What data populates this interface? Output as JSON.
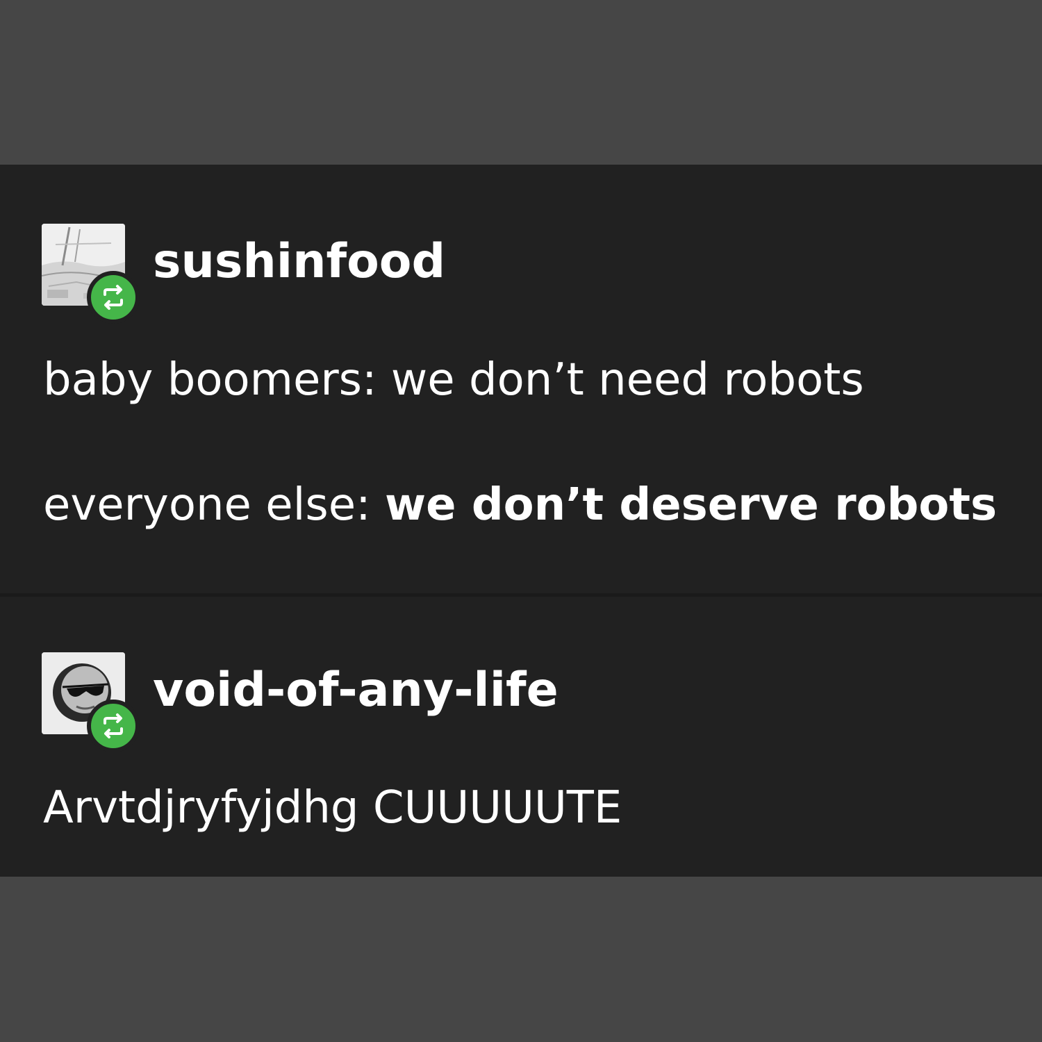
{
  "posts": [
    {
      "username": "sushinfood",
      "avatar": "landscape-sketch-avatar",
      "badge_icon": "reblog-icon",
      "lines": [
        {
          "prefix": "baby boomers: we don’t need robots",
          "bold": ""
        },
        {
          "prefix": "everyone else: ",
          "bold": "we don’t deserve robots"
        }
      ]
    },
    {
      "username": "void-of-any-life",
      "avatar": "sunglasses-face-avatar",
      "badge_icon": "reblog-icon",
      "lines": [
        {
          "prefix": "Arvtdjryfyjdhg CUUUUUTE",
          "bold": ""
        }
      ]
    }
  ],
  "colors": {
    "page_background": "#464646",
    "card_background": "#212121",
    "reblog_badge": "#45b649",
    "text": "#ffffff"
  }
}
